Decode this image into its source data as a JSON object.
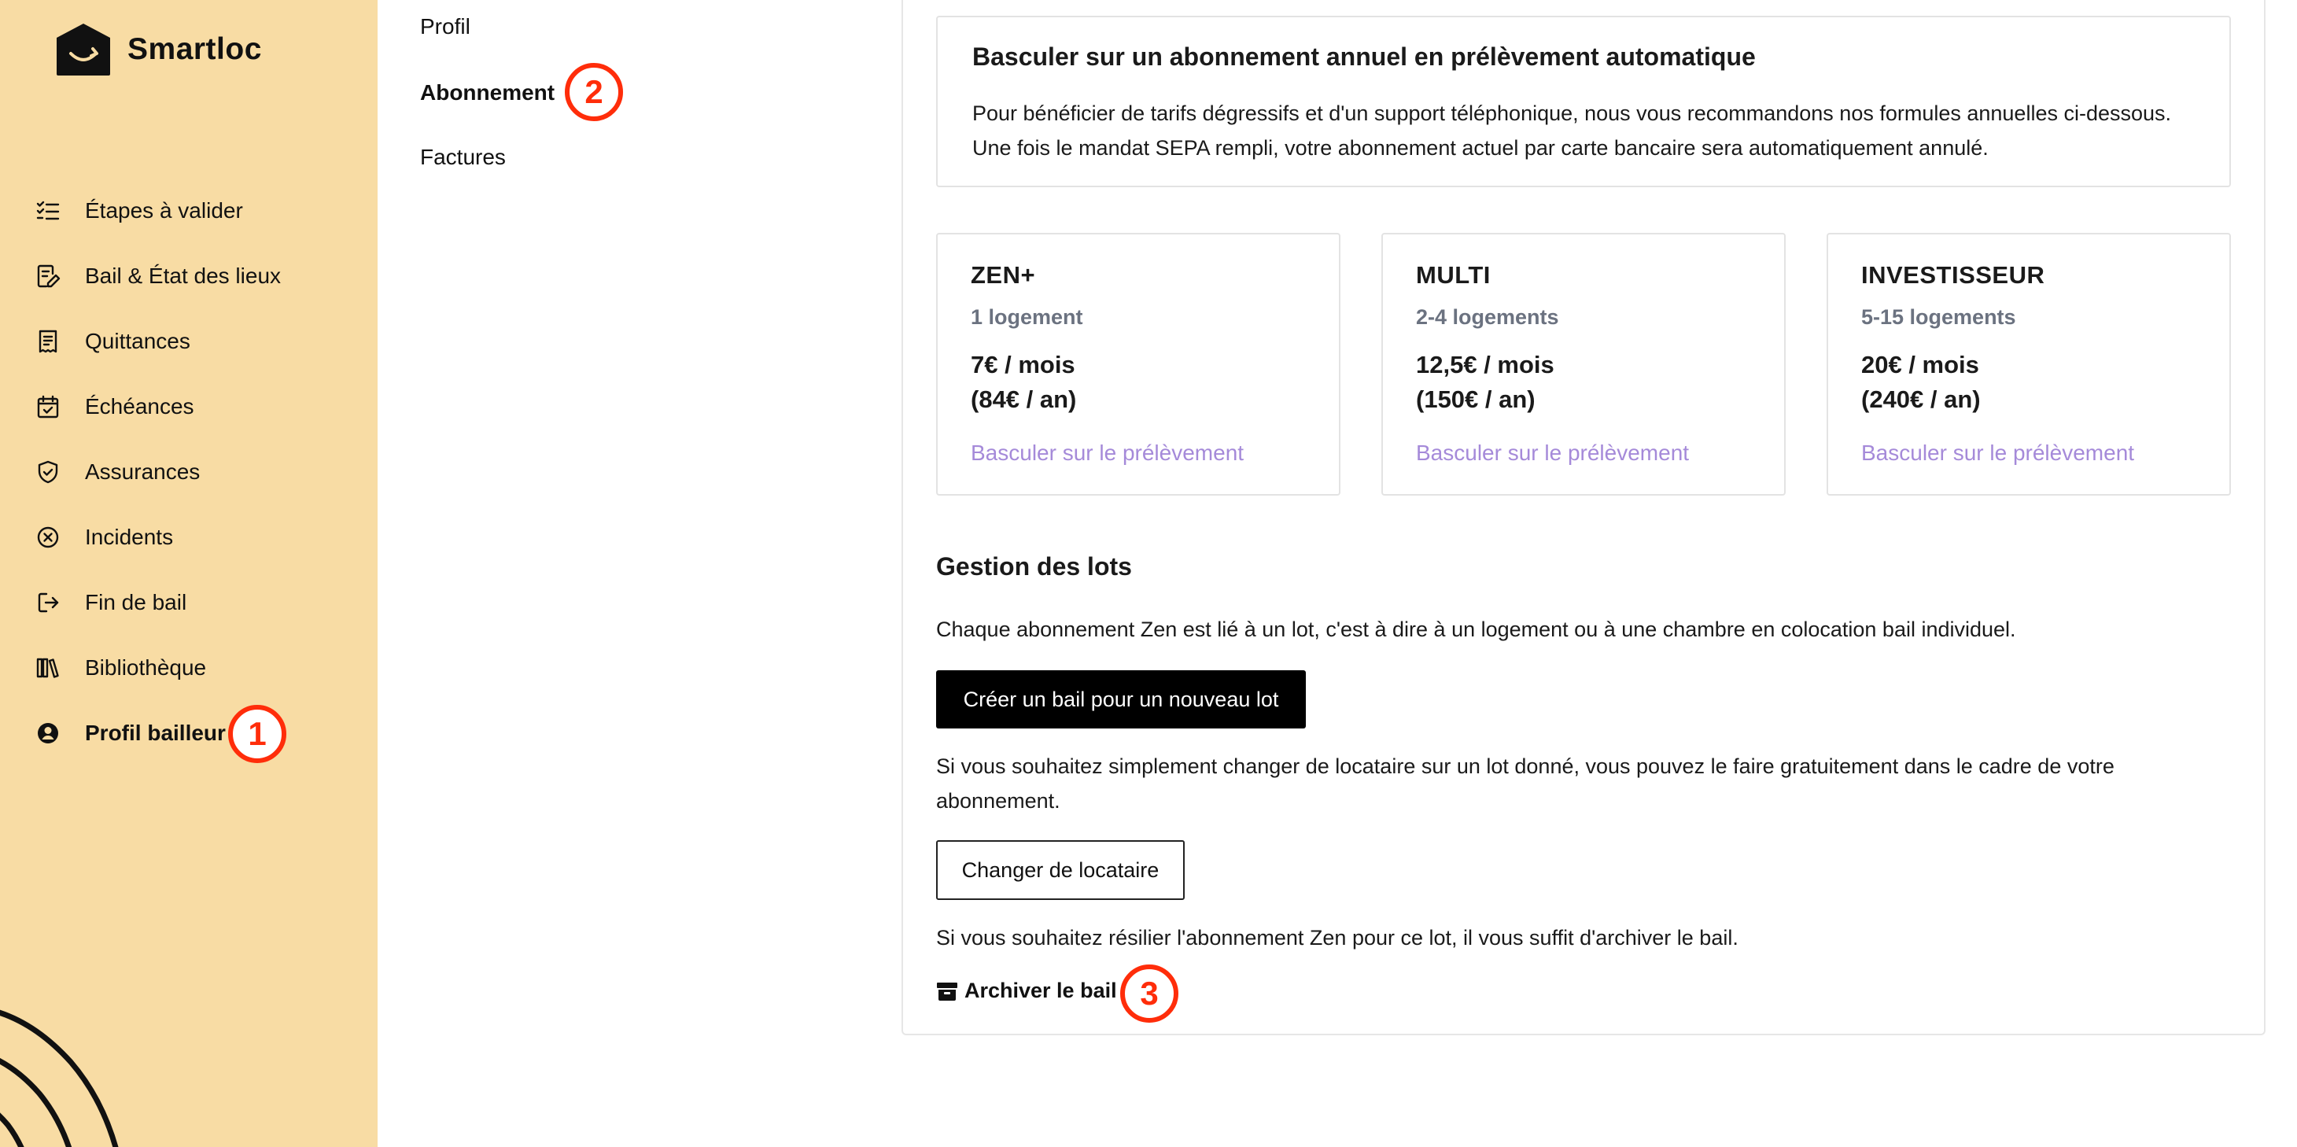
{
  "brand": {
    "name": "Smartloc",
    "logo_icon": "house-logo-icon"
  },
  "sidebar": {
    "items": [
      {
        "label": "Étapes à valider",
        "icon": "checklist-icon"
      },
      {
        "label": "Bail & État des lieux",
        "icon": "document-edit-icon"
      },
      {
        "label": "Quittances",
        "icon": "receipt-icon"
      },
      {
        "label": "Échéances",
        "icon": "calendar-check-icon"
      },
      {
        "label": "Assurances",
        "icon": "shield-check-icon"
      },
      {
        "label": "Incidents",
        "icon": "circle-x-icon"
      },
      {
        "label": "Fin de bail",
        "icon": "exit-icon"
      },
      {
        "label": "Bibliothèque",
        "icon": "library-icon"
      },
      {
        "label": "Profil bailleur",
        "icon": "user-circle-icon",
        "active": true
      }
    ]
  },
  "subnav": {
    "items": [
      {
        "label": "Profil"
      },
      {
        "label": "Abonnement",
        "active": true
      },
      {
        "label": "Factures"
      }
    ]
  },
  "badges": {
    "step1": "1",
    "step2": "2",
    "step3": "3"
  },
  "info": {
    "title": "Basculer sur un abonnement annuel en prélèvement automatique",
    "text": "Pour bénéficier de tarifs dégressifs et d'un support téléphonique, nous vous recommandons nos formules annuelles ci-dessous. Une fois le mandat SEPA rempli, votre abonnement actuel par carte bancaire sera automatiquement annulé."
  },
  "plans": [
    {
      "name": "ZEN+",
      "capacity": "1 logement",
      "price": "7€ / mois\n(84€ / an)",
      "link": "Basculer sur le prélèvement"
    },
    {
      "name": "MULTI",
      "capacity": "2-4 logements",
      "price": "12,5€ / mois\n(150€ / an)",
      "link": "Basculer sur le prélèvement"
    },
    {
      "name": "INVESTISSEUR",
      "capacity": "5-15 logements",
      "price": "20€ / mois\n(240€ / an)",
      "link": "Basculer sur le prélèvement"
    }
  ],
  "lots": {
    "title": "Gestion des lots",
    "intro": "Chaque abonnement Zen est lié à un lot, c'est à dire à un logement ou à une chambre en colocation bail individuel.",
    "create_button": "Créer un bail pour un nouveau lot",
    "change_text": "Si vous souhaitez simplement changer de locataire sur un lot donné, vous pouvez le faire gratuitement dans le cadre de votre abonnement.",
    "change_button": "Changer de locataire",
    "archive_text": "Si vous souhaitez résilier l'abonnement Zen pour ce lot, il vous suffit d'archiver le bail.",
    "archive_link": "Archiver le bail",
    "archive_icon": "archive-box-icon"
  },
  "colors": {
    "sidebar_bg": "#f8dca4",
    "badge": "#ff2d0a",
    "link_purple": "#a58ad9",
    "muted_text": "#6b7280"
  }
}
